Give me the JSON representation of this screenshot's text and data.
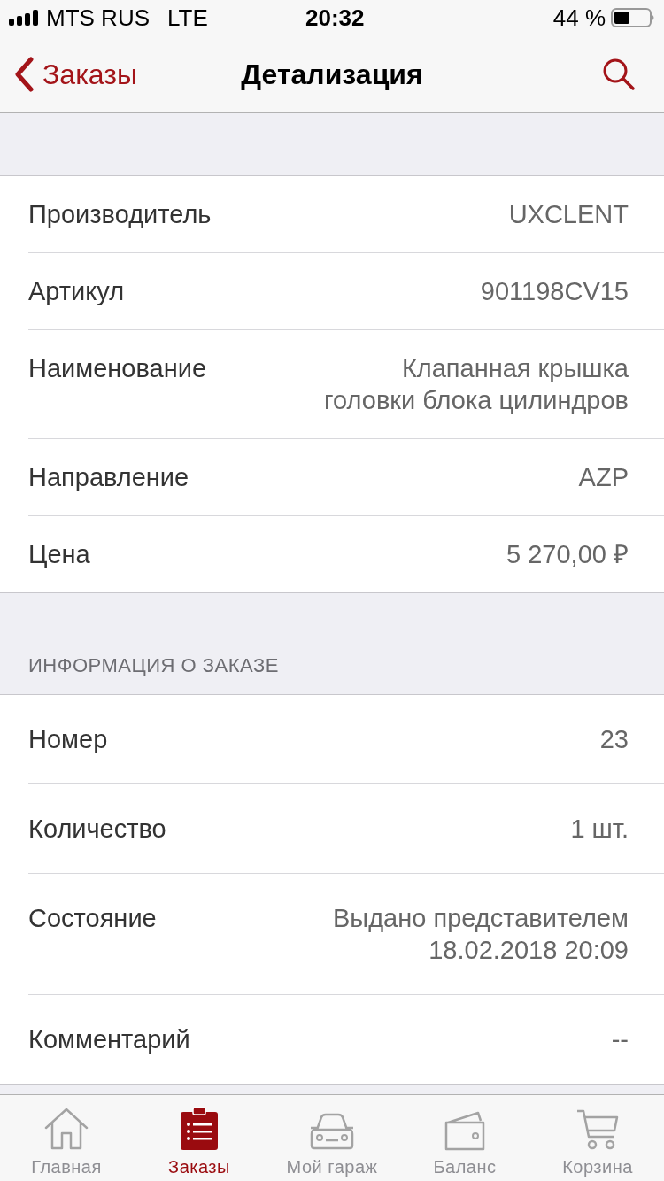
{
  "status_bar": {
    "carrier": "MTS RUS",
    "network": "LTE",
    "time": "20:32",
    "battery": "44 %"
  },
  "nav": {
    "back": "Заказы",
    "title": "Детализация"
  },
  "sections": [
    {
      "rows": [
        {
          "label": "Производитель",
          "value": [
            "UXCLENT"
          ]
        },
        {
          "label": "Артикул",
          "value": [
            "901198CV15"
          ]
        },
        {
          "label": "Наименование",
          "value": [
            "Клапанная крышка",
            "головки блока цилиндров"
          ]
        },
        {
          "label": "Направление",
          "value": [
            "AZP"
          ]
        },
        {
          "label": "Цена",
          "value": [
            "5 270,00 ₽"
          ]
        }
      ]
    },
    {
      "header": "ИНФОРМАЦИЯ О ЗАКАЗЕ",
      "rows": [
        {
          "label": "Номер",
          "value": [
            "23"
          ]
        },
        {
          "label": "Количество",
          "value": [
            "1 шт."
          ]
        },
        {
          "label": "Состояние",
          "value": [
            "Выдано представителем",
            "18.02.2018 20:09"
          ]
        },
        {
          "label": "Комментарий",
          "value": [
            "--"
          ]
        }
      ]
    }
  ],
  "tabs": [
    {
      "label": "Главная",
      "selected": false
    },
    {
      "label": "Заказы",
      "selected": true
    },
    {
      "label": "Мой гараж",
      "selected": false
    },
    {
      "label": "Баланс",
      "selected": false
    },
    {
      "label": "Корзина",
      "selected": false
    }
  ]
}
